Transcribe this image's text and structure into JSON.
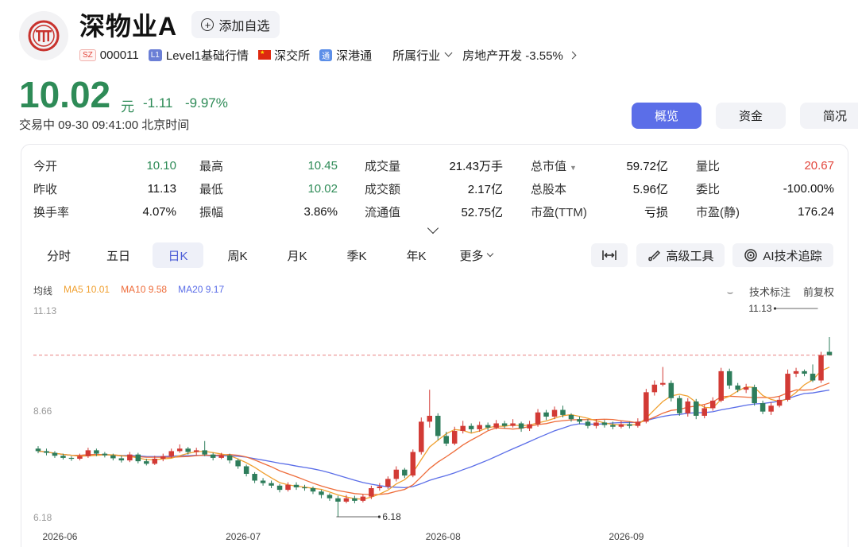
{
  "header": {
    "name": "深物业A",
    "watch_label": "添加自选",
    "market_badge": "SZ",
    "code": "000011",
    "level_badge": "L1",
    "level_label": "Level1基础行情",
    "exchange": "深交所",
    "connect_badge": "通",
    "connect": "深港通",
    "industry_label": "所属行业",
    "industry_value": "房地产开发 -3.55%"
  },
  "price": {
    "last": "10.02",
    "unit": "元",
    "change": "-1.11",
    "change_pct": "-9.97%",
    "status": "交易中 09-30 09:41:00 北京时间"
  },
  "view_tabs": [
    {
      "label": "概览",
      "active": true
    },
    {
      "label": "资金",
      "active": false
    },
    {
      "label": "简况",
      "active": false
    }
  ],
  "quote": [
    [
      {
        "label": "今开",
        "value": "10.10",
        "tone": "green"
      },
      {
        "label": "昨收",
        "value": "11.13",
        "tone": "plain"
      },
      {
        "label": "换手率",
        "value": "4.07%",
        "tone": "plain"
      }
    ],
    [
      {
        "label": "最高",
        "value": "10.45",
        "tone": "green"
      },
      {
        "label": "最低",
        "value": "10.02",
        "tone": "green"
      },
      {
        "label": "振幅",
        "value": "3.86%",
        "tone": "plain"
      }
    ],
    [
      {
        "label": "成交量",
        "value": "21.43万手",
        "tone": "plain"
      },
      {
        "label": "成交额",
        "value": "2.17亿",
        "tone": "plain"
      },
      {
        "label": "流通值",
        "value": "52.75亿",
        "tone": "plain"
      }
    ],
    [
      {
        "label": "总市值",
        "value": "59.72亿",
        "tone": "plain"
      },
      {
        "label": "总股本",
        "value": "5.96亿",
        "tone": "plain"
      },
      {
        "label": "市盈(TTM)",
        "value": "亏损",
        "tone": "plain"
      }
    ],
    [
      {
        "label": "量比",
        "value": "20.67",
        "tone": "red"
      },
      {
        "label": "委比",
        "value": "-100.00%",
        "tone": "plain"
      },
      {
        "label": "市盈(静)",
        "value": "176.24",
        "tone": "plain"
      }
    ]
  ],
  "period_tabs": [
    {
      "label": "分时",
      "active": false
    },
    {
      "label": "五日",
      "active": false
    },
    {
      "label": "日K",
      "active": true
    },
    {
      "label": "周K",
      "active": false
    },
    {
      "label": "月K",
      "active": false
    },
    {
      "label": "季K",
      "active": false
    },
    {
      "label": "年K",
      "active": false
    },
    {
      "label": "更多",
      "active": false
    }
  ],
  "tools": {
    "high_tools": "高级工具",
    "ai_tracking": "AI技术追踪"
  },
  "chart_options": {
    "mark": "技术标注",
    "adjust": "前复权"
  },
  "chart_data": {
    "type": "candlestick",
    "legend": {
      "label": "均线",
      "ma5": "MA5 10.01",
      "ma10": "MA10 9.58",
      "ma20": "MA20 9.17"
    },
    "colors": {
      "up": "#d23a35",
      "down": "#2e7d5b",
      "ma5": "#f0a030",
      "ma10": "#ee6c3a",
      "ma20": "#5b6ee8",
      "ref": "#e88080"
    },
    "y_ticks": [
      "11.13",
      "8.66",
      "6.18"
    ],
    "ylim": [
      6.18,
      11.13
    ],
    "x_ticks": [
      "2026-06",
      "2026-07",
      "2026-08",
      "2026-09"
    ],
    "x_tick_index": [
      3,
      25,
      49,
      71
    ],
    "ref_line": 10.02,
    "max_label": "11.13",
    "min_label": "6.18",
    "max_index": 94,
    "min_index": 36,
    "candles": [
      [
        7.8,
        7.74,
        7.86,
        7.69
      ],
      [
        7.74,
        7.7,
        7.8,
        7.64
      ],
      [
        7.7,
        7.63,
        7.74,
        7.58
      ],
      [
        7.63,
        7.58,
        7.68,
        7.54
      ],
      [
        7.58,
        7.56,
        7.62,
        7.51
      ],
      [
        7.56,
        7.62,
        7.68,
        7.52
      ],
      [
        7.62,
        7.76,
        7.82,
        7.58
      ],
      [
        7.76,
        7.68,
        7.8,
        7.62
      ],
      [
        7.68,
        7.64,
        7.72,
        7.59
      ],
      [
        7.64,
        7.57,
        7.68,
        7.52
      ],
      [
        7.57,
        7.52,
        7.63,
        7.47
      ],
      [
        7.52,
        7.66,
        7.72,
        7.48
      ],
      [
        7.66,
        7.5,
        7.7,
        7.45
      ],
      [
        7.5,
        7.44,
        7.56,
        7.4
      ],
      [
        7.44,
        7.56,
        7.63,
        7.41
      ],
      [
        7.56,
        7.62,
        7.68,
        7.5
      ],
      [
        7.62,
        7.74,
        7.8,
        7.58
      ],
      [
        7.74,
        7.8,
        7.9,
        7.7
      ],
      [
        7.8,
        7.72,
        7.84,
        7.66
      ],
      [
        7.72,
        7.76,
        7.82,
        7.64
      ],
      [
        7.76,
        7.66,
        7.98,
        7.62
      ],
      [
        7.66,
        7.58,
        7.7,
        7.52
      ],
      [
        7.58,
        7.64,
        7.7,
        7.55
      ],
      [
        7.64,
        7.52,
        7.68,
        7.45
      ],
      [
        7.52,
        7.38,
        7.56,
        7.32
      ],
      [
        7.38,
        7.2,
        7.42,
        7.14
      ],
      [
        7.2,
        7.04,
        7.24,
        6.98
      ],
      [
        7.04,
        6.98,
        7.1,
        6.92
      ],
      [
        6.98,
        6.92,
        7.04,
        6.86
      ],
      [
        6.92,
        6.82,
        6.96,
        6.76
      ],
      [
        6.82,
        6.94,
        7.0,
        6.78
      ],
      [
        6.94,
        6.88,
        7.0,
        6.82
      ],
      [
        6.88,
        6.86,
        6.94,
        6.8
      ],
      [
        6.86,
        6.78,
        6.9,
        6.72
      ],
      [
        6.78,
        6.7,
        6.82,
        6.62
      ],
      [
        6.7,
        6.62,
        6.74,
        6.56
      ],
      [
        6.62,
        6.54,
        6.68,
        6.18
      ],
      [
        6.54,
        6.62,
        6.7,
        6.5
      ],
      [
        6.62,
        6.56,
        6.68,
        6.5
      ],
      [
        6.56,
        6.66,
        6.72,
        6.52
      ],
      [
        6.66,
        6.86,
        6.92,
        6.6
      ],
      [
        6.86,
        6.9,
        6.98,
        6.8
      ],
      [
        6.9,
        7.08,
        7.14,
        6.84
      ],
      [
        7.08,
        7.3,
        7.38,
        7.02
      ],
      [
        7.3,
        7.16,
        7.34,
        7.1
      ],
      [
        7.16,
        7.72,
        7.78,
        7.12
      ],
      [
        7.72,
        8.44,
        8.54,
        7.66
      ],
      [
        8.44,
        8.58,
        9.2,
        8.3
      ],
      [
        8.58,
        8.1,
        8.64,
        8.0
      ],
      [
        8.1,
        7.92,
        8.2,
        7.86
      ],
      [
        7.92,
        8.22,
        8.32,
        7.88
      ],
      [
        8.22,
        8.34,
        8.46,
        8.16
      ],
      [
        8.34,
        8.26,
        8.4,
        8.18
      ],
      [
        8.26,
        8.36,
        8.44,
        8.2
      ],
      [
        8.36,
        8.3,
        8.42,
        8.24
      ],
      [
        8.3,
        8.4,
        8.48,
        8.26
      ],
      [
        8.4,
        8.34,
        8.46,
        8.28
      ],
      [
        8.34,
        8.4,
        8.5,
        8.3
      ],
      [
        8.4,
        8.28,
        8.44,
        8.2
      ],
      [
        8.28,
        8.38,
        8.46,
        8.22
      ],
      [
        8.38,
        8.66,
        8.74,
        8.32
      ],
      [
        8.66,
        8.56,
        8.72,
        8.48
      ],
      [
        8.56,
        8.72,
        8.8,
        8.5
      ],
      [
        8.72,
        8.6,
        8.82,
        8.54
      ],
      [
        8.6,
        8.5,
        8.64,
        8.44
      ],
      [
        8.5,
        8.44,
        8.56,
        8.38
      ],
      [
        8.44,
        8.34,
        8.5,
        8.28
      ],
      [
        8.34,
        8.42,
        8.5,
        8.28
      ],
      [
        8.42,
        8.36,
        8.48,
        8.3
      ],
      [
        8.36,
        8.32,
        8.44,
        8.26
      ],
      [
        8.32,
        8.38,
        8.46,
        8.28
      ],
      [
        8.38,
        8.34,
        8.44,
        8.28
      ],
      [
        8.34,
        8.44,
        8.52,
        8.3
      ],
      [
        8.44,
        9.14,
        9.22,
        8.4
      ],
      [
        9.14,
        9.32,
        9.42,
        9.06
      ],
      [
        9.32,
        9.36,
        9.74,
        9.28
      ],
      [
        9.36,
        9.0,
        9.42,
        8.92
      ],
      [
        9.0,
        8.64,
        9.06,
        8.58
      ],
      [
        8.64,
        8.92,
        9.0,
        8.56
      ],
      [
        8.92,
        8.58,
        8.98,
        8.5
      ],
      [
        8.58,
        8.76,
        8.84,
        8.52
      ],
      [
        8.76,
        8.94,
        9.02,
        8.7
      ],
      [
        8.94,
        9.64,
        9.72,
        8.9
      ],
      [
        9.64,
        9.3,
        9.7,
        9.22
      ],
      [
        9.3,
        9.2,
        9.36,
        9.14
      ],
      [
        9.2,
        9.26,
        9.34,
        9.12
      ],
      [
        9.26,
        8.88,
        9.32,
        8.82
      ],
      [
        8.88,
        8.68,
        8.94,
        8.62
      ],
      [
        8.68,
        8.82,
        8.9,
        8.6
      ],
      [
        8.82,
        8.96,
        9.04,
        8.78
      ],
      [
        8.96,
        9.58,
        9.68,
        8.92
      ],
      [
        9.58,
        9.64,
        9.72,
        9.5
      ],
      [
        9.64,
        9.58,
        9.68,
        9.52
      ],
      [
        9.58,
        9.42,
        9.8,
        9.38
      ],
      [
        9.42,
        10.02,
        10.1,
        9.36
      ],
      [
        10.1,
        10.02,
        10.45,
        10.02
      ]
    ]
  }
}
